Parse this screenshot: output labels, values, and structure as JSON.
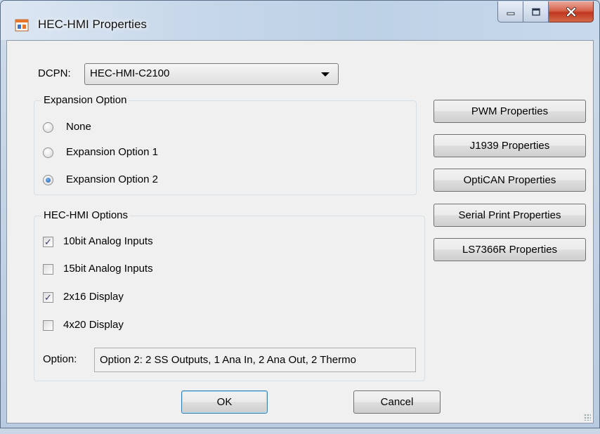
{
  "window": {
    "title": "HEC-HMI Properties",
    "minimize_glyph": "▁",
    "maximize_glyph": "□",
    "close_glyph": "X"
  },
  "dcpn": {
    "label": "DCPN:",
    "value": "HEC-HMI-C2100"
  },
  "expansion": {
    "title": "Expansion Option",
    "options": [
      {
        "label": "None",
        "selected": false
      },
      {
        "label": "Expansion Option 1",
        "selected": false
      },
      {
        "label": "Expansion Option 2",
        "selected": true
      }
    ]
  },
  "hmi_options": {
    "title": "HEC-HMI Options",
    "items": [
      {
        "label": "10bit Analog Inputs",
        "checked": true
      },
      {
        "label": "15bit Analog Inputs",
        "checked": false
      },
      {
        "label": "2x16 Display",
        "checked": true
      },
      {
        "label": "4x20 Display",
        "checked": false
      }
    ],
    "option_label": "Option:",
    "option_value": "Option 2: 2 SS Outputs, 1 Ana In, 2 Ana Out, 2 Thermo"
  },
  "side_buttons": [
    "PWM Properties",
    "J1939 Properties",
    "OptiCAN Properties",
    "Serial Print Properties",
    "LS7366R Properties"
  ],
  "footer": {
    "ok_label": "OK",
    "cancel_label": "Cancel"
  }
}
